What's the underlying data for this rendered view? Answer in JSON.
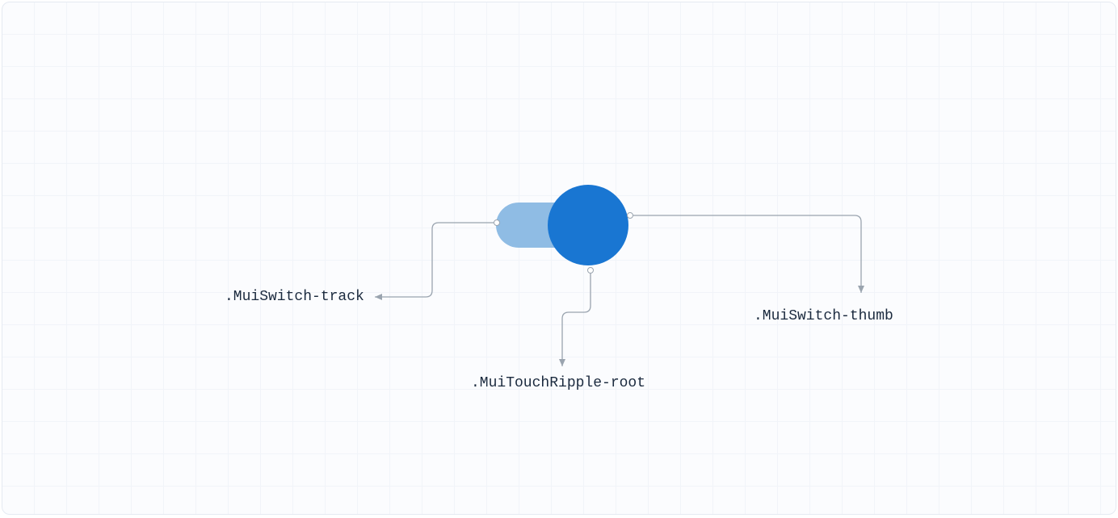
{
  "labels": {
    "track": ".MuiSwitch-track",
    "thumb": ".MuiSwitch-thumb",
    "ripple": ".MuiTouchRipple-root"
  }
}
